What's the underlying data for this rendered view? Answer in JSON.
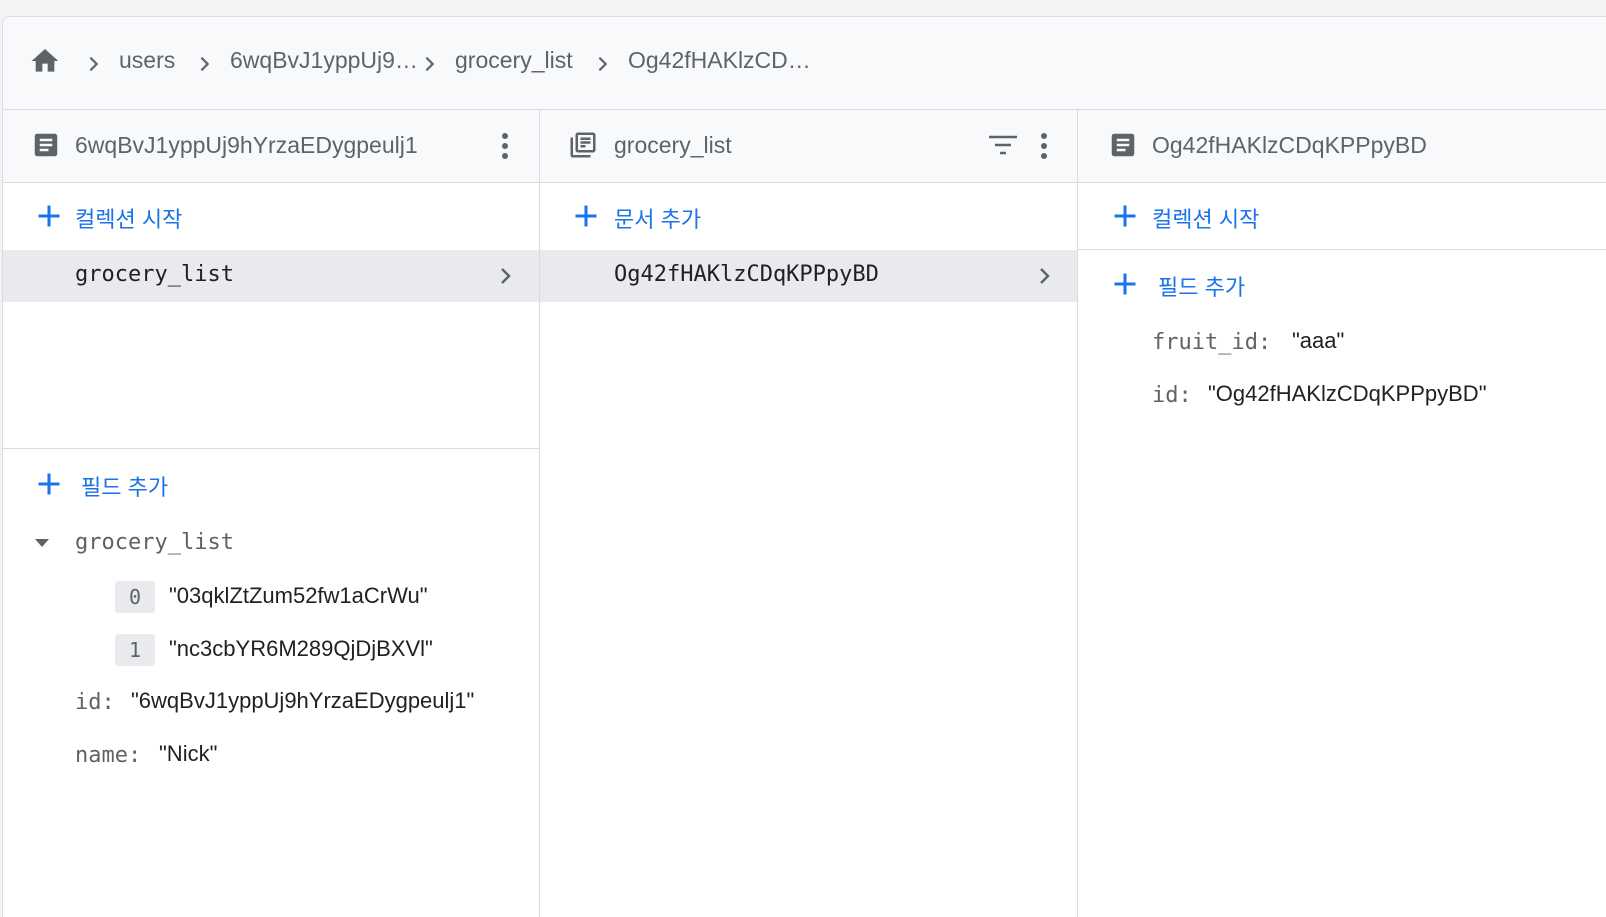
{
  "breadcrumb": {
    "home_icon": "home-icon",
    "items": [
      "users",
      "6wqBvJ1yppUj9…",
      "grocery_list",
      "Og42fHAKlzCD…"
    ]
  },
  "panels": [
    {
      "icon": "document-icon",
      "title": "6wqBvJ1yppUj9hYrzaEDygpeulj1",
      "action_label": "컬렉션 시작",
      "selected_item": "grocery_list",
      "add_field_label": "필드 추가",
      "fields": {
        "array_key": "grocery_list",
        "array_items": [
          {
            "index": "0",
            "value": "\"03qklZtZum52fw1aCrWu\""
          },
          {
            "index": "1",
            "value": "\"nc3cbYR6M289QjDjBXVl\""
          }
        ],
        "id_key": "id:",
        "id_value": "\"6wqBvJ1yppUj9hYrzaEDygpeulj1\"",
        "name_key": "name:",
        "name_value": "\"Nick\""
      }
    },
    {
      "icon": "collection-icon",
      "title": "grocery_list",
      "action_label": "문서 추가",
      "selected_item": "Og42fHAKlzCDqKPPpyBD"
    },
    {
      "icon": "document-icon",
      "title": "Og42fHAKlzCDqKPPpyBD",
      "action_label": "컬렉션 시작",
      "add_field_label": "필드 추가",
      "fields": {
        "fruit_key": "fruit_id:",
        "fruit_value": "\"aaa\"",
        "id_key": "id:",
        "id_value": "\"Og42fHAKlzCDqKPPpyBD\""
      }
    }
  ],
  "colors": {
    "accent": "#1a73e8",
    "header_bg": "#f8f9fa",
    "selected_bg": "#e8eaed",
    "muted_text": "#5f6368"
  }
}
